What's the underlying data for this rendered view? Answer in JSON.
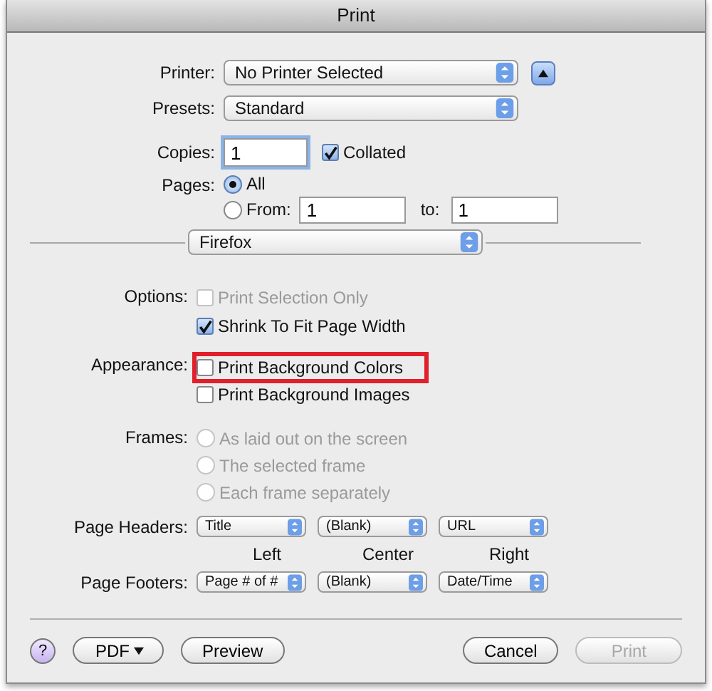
{
  "window": {
    "title": "Print"
  },
  "printer": {
    "label": "Printer:",
    "value": "No Printer Selected"
  },
  "presets": {
    "label": "Presets:",
    "value": "Standard"
  },
  "copies": {
    "label": "Copies:",
    "value": "1",
    "collated": {
      "label": "Collated",
      "checked": true
    }
  },
  "pages": {
    "label": "Pages:",
    "options": [
      {
        "label": "All",
        "selected": true
      },
      {
        "label": "From:",
        "selected": false
      }
    ],
    "from": "1",
    "to_label": "to:",
    "to": "1"
  },
  "section": {
    "value": "Firefox"
  },
  "options": {
    "label": "Options:",
    "items": [
      {
        "label": "Print Selection Only",
        "checked": false,
        "disabled": true
      },
      {
        "label": "Shrink To Fit Page Width",
        "checked": true,
        "disabled": false
      }
    ]
  },
  "appearance": {
    "label": "Appearance:",
    "items": [
      {
        "label": "Print Background Colors",
        "checked": false,
        "highlighted": true
      },
      {
        "label": "Print Background Images",
        "checked": false,
        "highlighted": false
      }
    ]
  },
  "frames": {
    "label": "Frames:",
    "disabled": true,
    "options": [
      {
        "label": "As laid out on the screen",
        "selected": false
      },
      {
        "label": "The selected frame",
        "selected": false
      },
      {
        "label": "Each frame separately",
        "selected": false
      }
    ]
  },
  "headers": {
    "label": "Page Headers:",
    "values": [
      "Title",
      "(Blank)",
      "URL"
    ]
  },
  "positions": [
    "Left",
    "Center",
    "Right"
  ],
  "footers": {
    "label": "Page Footers:",
    "values": [
      "Page # of #",
      "(Blank)",
      "Date/Time"
    ]
  },
  "buttons": {
    "help": "?",
    "pdf": "PDF",
    "preview": "Preview",
    "cancel": "Cancel",
    "print": {
      "label": "Print",
      "disabled": true
    }
  }
}
